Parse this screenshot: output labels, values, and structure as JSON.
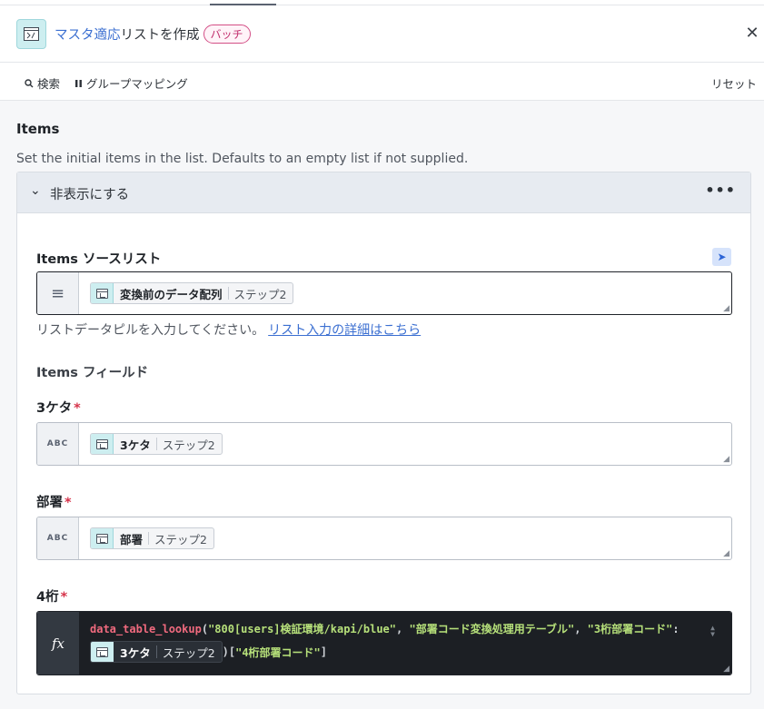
{
  "header": {
    "title_link": "マスタ適応",
    "title_rest": "リストを作成",
    "badge": "バッチ",
    "close_icon": "close-icon"
  },
  "toolbar": {
    "search_label": "検索",
    "group_mapping_label": "グループマッピング",
    "reset_label": "リセット"
  },
  "section": {
    "title": "Items",
    "description": "Set the initial items in the list. Defaults to an empty list if not supplied."
  },
  "panel": {
    "toggle_label": "非表示にする",
    "more_icon": "more-icon"
  },
  "source_list": {
    "label": "Items ソースリスト",
    "pill_name": "変換前のデータ配列",
    "pill_step": "ステップ2",
    "hint_text": "リストデータピルを入力してください。",
    "hint_link": "リスト入力の詳細はこちら"
  },
  "fields_label": "Items フィールド",
  "fields": [
    {
      "label": "3ケタ",
      "required": "*",
      "prefix": "ABC",
      "pill_name": "3ケタ",
      "pill_step": "ステップ2"
    },
    {
      "label": "部署",
      "required": "*",
      "prefix": "ABC",
      "pill_name": "部署",
      "pill_step": "ステップ2"
    },
    {
      "label": "4桁",
      "required": "*",
      "prefix": "fx",
      "pill_name": "3ケタ",
      "pill_step": "ステップ2"
    }
  ],
  "formula": {
    "fn": "data_table_lookup",
    "open": "(",
    "arg1": "\"800[users]検証環境/kapi/blue\"",
    "sep1": ", ",
    "arg2": "\"部署コード変換処理用テーブル\"",
    "sep2": ", ",
    "arg3": "\"3桁部署コード\"",
    "colon": ":",
    "close_open_bracket": ")[",
    "key": "\"4桁部署コード\"",
    "close_bracket": "]"
  }
}
